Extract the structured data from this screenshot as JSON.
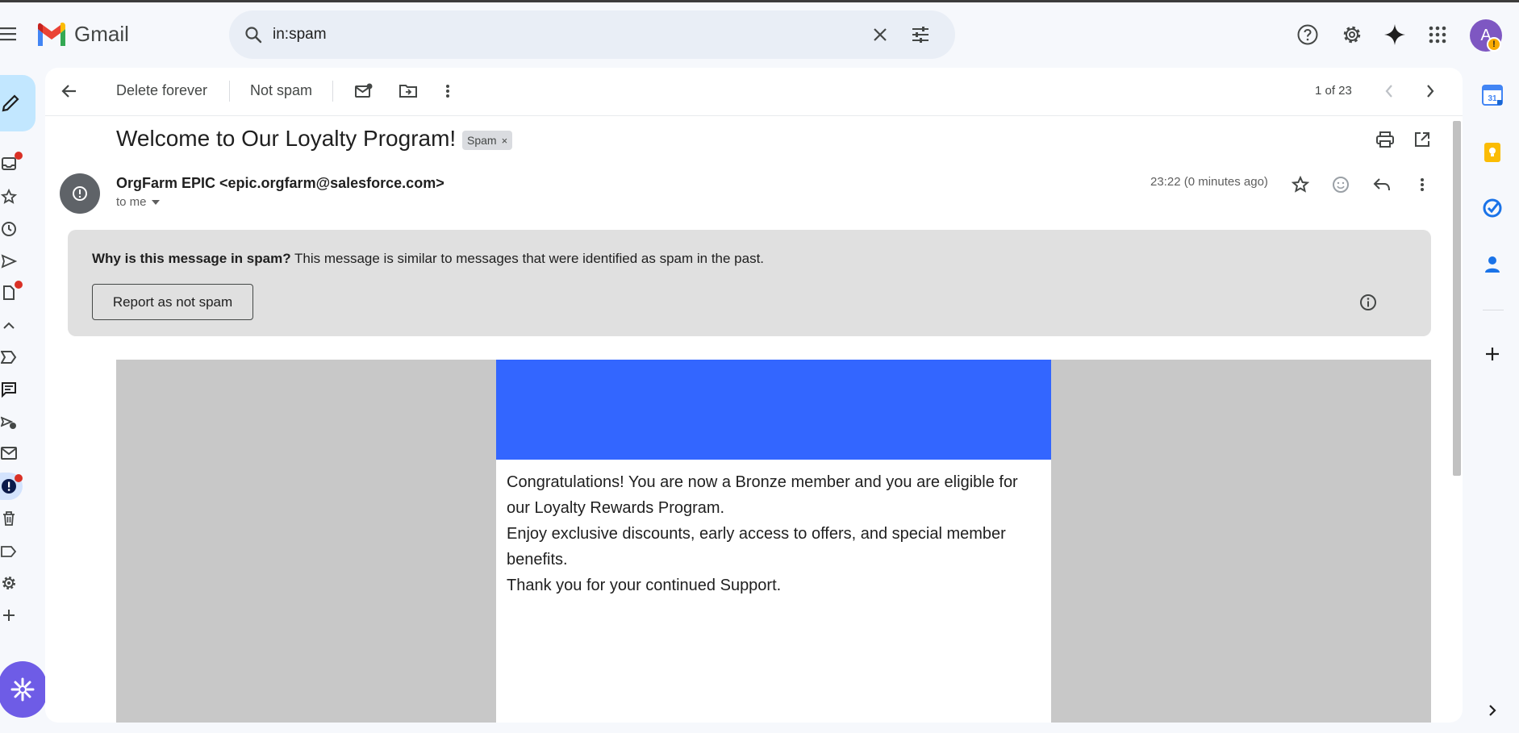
{
  "app": {
    "name": "Gmail"
  },
  "search": {
    "value": "in:spam"
  },
  "account": {
    "initial": "A",
    "badge": "!"
  },
  "toolbar": {
    "delete_forever_label": "Delete forever",
    "not_spam_label": "Not spam",
    "pager_text": "1 of 23"
  },
  "message": {
    "subject": "Welcome to Our Loyalty Program!",
    "label_chip": "Spam",
    "label_chip_close": "×",
    "sender": "OrgFarm EPIC <epic.orgfarm@salesforce.com>",
    "recipient": "to me",
    "timestamp": "23:22 (0 minutes ago)"
  },
  "spam_banner": {
    "question": "Why is this message in spam?",
    "explanation": " This message is similar to messages that were identified as spam in the past.",
    "report_button": "Report as not spam"
  },
  "email_body": {
    "banner_color": "#3366ff",
    "lines": [
      "Congratulations! You are now a Bronze member and you are eligible for our Loyalty Rewards Program.",
      "Enjoy exclusive discounts, early access to offers, and special member benefits.",
      "Thank you for your continued Support."
    ]
  },
  "side_panel": {
    "calendar_day": "31"
  },
  "colors": {
    "background": "#f6f8fc",
    "compose": "#c2e7ff",
    "spam_banner": "#e0e0e0",
    "unread_dot": "#d93025",
    "avatar": "#7e57c2"
  }
}
